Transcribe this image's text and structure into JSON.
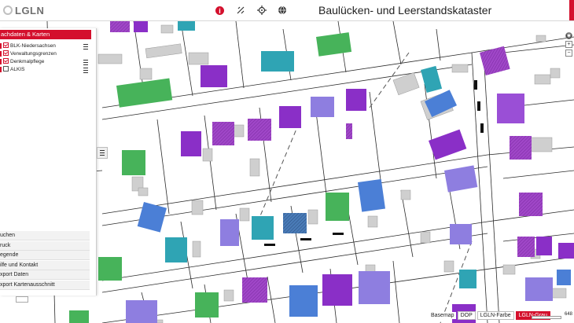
{
  "header": {
    "logo_text": "LGLN",
    "title": "Baulücken- und Leerstandskataster",
    "icons": [
      "info-icon",
      "satellite-icon",
      "target-icon",
      "globe-icon"
    ]
  },
  "panel": {
    "header": "achdaten & Karten",
    "layers": [
      {
        "label": "BLK-Niedersachsen",
        "checked": true
      },
      {
        "label": "Verwaltungsgrenzen",
        "checked": true
      },
      {
        "label": "Denkmalpflege",
        "checked": true
      },
      {
        "label": "ALKIS",
        "checked": false
      }
    ],
    "menu": [
      {
        "label": "uchen"
      },
      {
        "label": "ruck"
      },
      {
        "label": "egende"
      },
      {
        "label": "ilfe und Kontakt"
      },
      {
        "label": "xport Daten"
      },
      {
        "label": "xport Kartenausschnitt"
      }
    ]
  },
  "basemap": {
    "label": "Basemap",
    "options": [
      {
        "label": "DOP",
        "active": false
      },
      {
        "label": "LGLN-Farbe",
        "active": false
      },
      {
        "label": "LGLN-Grau",
        "active": true
      }
    ]
  },
  "scale": {
    "label": "648"
  },
  "colors": {
    "accent": "#d4102d",
    "green": "#47b35a",
    "teal": "#2fa4b4",
    "purple": "#8a2fc7",
    "violet": "#9a4fd6",
    "blue": "#4b7fd6",
    "lavender": "#8e7ee0",
    "grey": "#cfcfcf"
  }
}
